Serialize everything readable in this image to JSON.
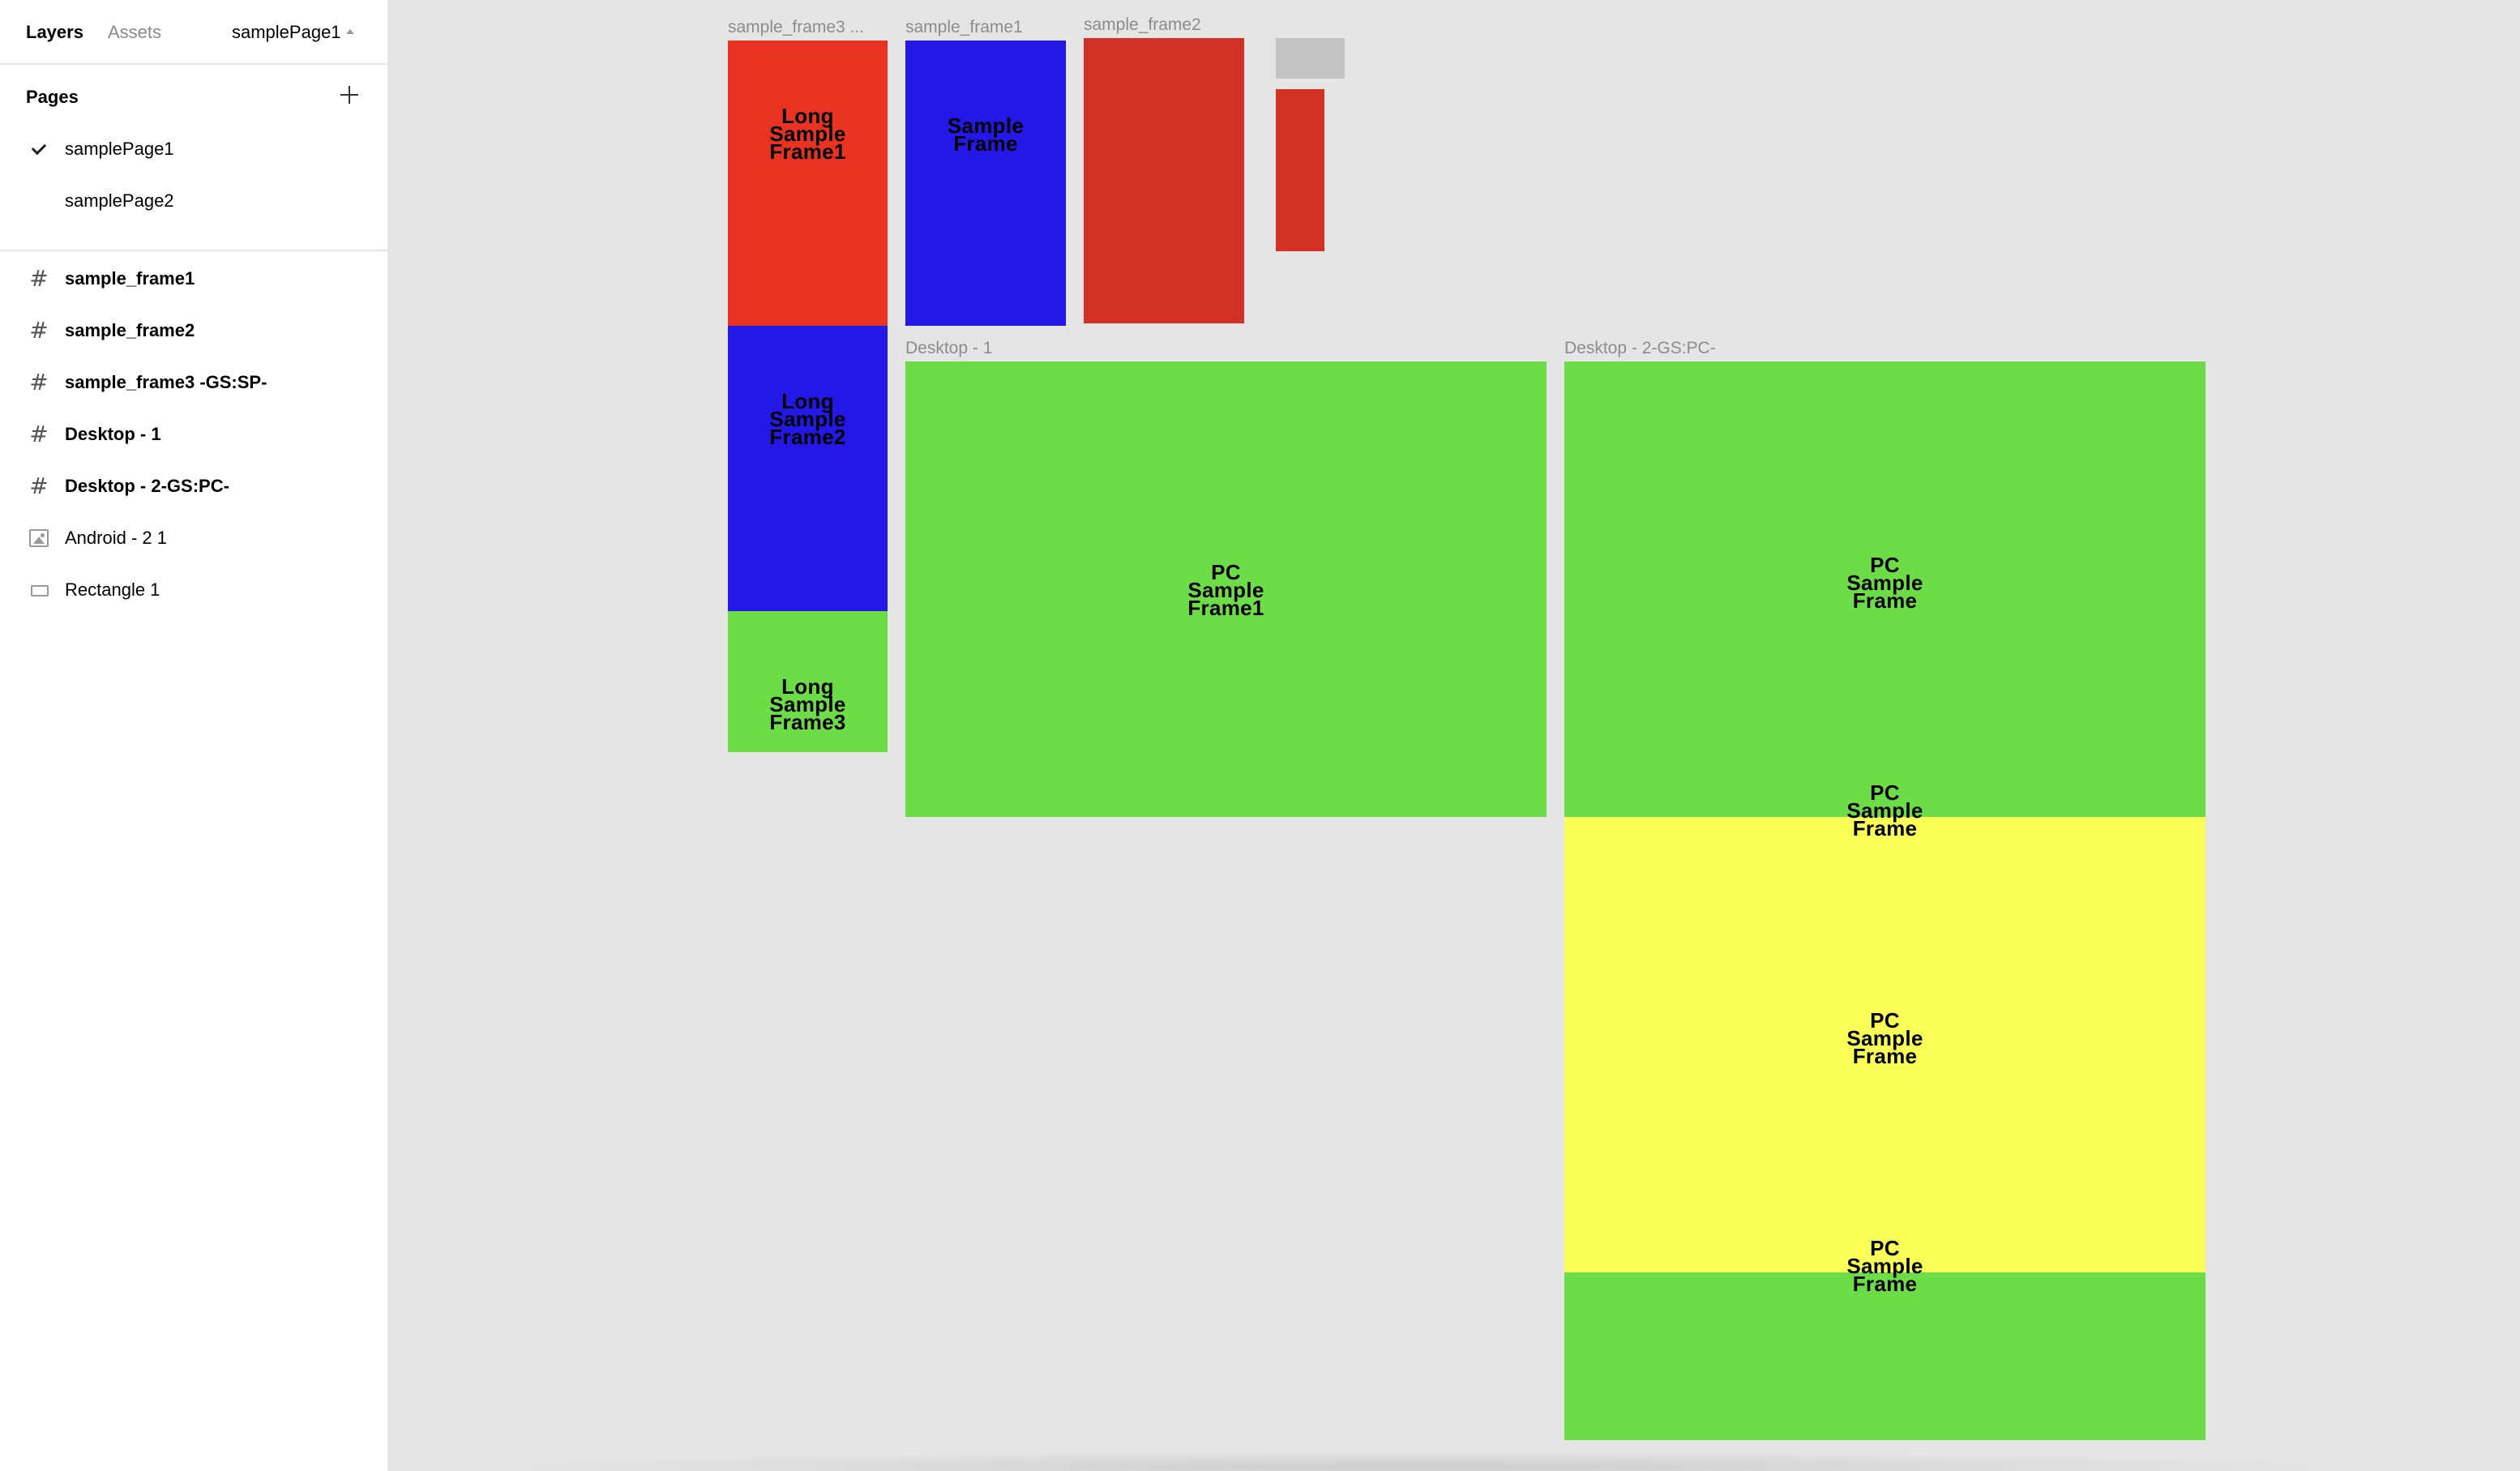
{
  "sidebar": {
    "tabs": {
      "layers": "Layers",
      "assets": "Assets"
    },
    "current_page": "samplePage1",
    "pages_title": "Pages",
    "pages": [
      {
        "label": "samplePage1",
        "selected": true
      },
      {
        "label": "samplePage2",
        "selected": false
      }
    ],
    "layers": [
      {
        "label": "sample_frame1",
        "icon": "frame-icon"
      },
      {
        "label": "sample_frame2",
        "icon": "frame-icon"
      },
      {
        "label": "sample_frame3 -GS:SP-",
        "icon": "frame-icon"
      },
      {
        "label": "Desktop - 1",
        "icon": "frame-icon"
      },
      {
        "label": "Desktop - 2-GS:PC-",
        "icon": "frame-icon"
      },
      {
        "label": "Android - 2 1",
        "icon": "image-icon"
      },
      {
        "label": "Rectangle 1",
        "icon": "rectangle-icon"
      }
    ]
  },
  "canvas": {
    "frame_labels": {
      "sample_frame3": "sample_frame3 ...",
      "sample_frame1": "sample_frame1",
      "sample_frame2": "sample_frame2",
      "desktop_1": "Desktop - 1",
      "desktop_2": "Desktop - 2-GS:PC-"
    },
    "texts": {
      "long_frame1": "Long\nSample\nFrame1",
      "long_frame2": "Long\nSample\nFrame2",
      "long_frame3": "Long\nSample\nFrame3",
      "sample_frame": "Sample\nFrame",
      "pc_frame1": "PC\nSample\nFrame1",
      "pc_frame_a": "PC\nSample\nFrame",
      "pc_frame_b": "PC\nSample\nFrame",
      "pc_frame_c": "PC\nSample\nFrame",
      "pc_frame_d": "PC\nSample\nFrame"
    },
    "colors": {
      "red": "#e83323",
      "dark_red": "#d33126",
      "blue": "#2418e6",
      "green": "#6ddd47",
      "yellow": "#f9ff56",
      "gray": "#c4c4c4",
      "canvas_bg": "#e5e5e5"
    }
  }
}
